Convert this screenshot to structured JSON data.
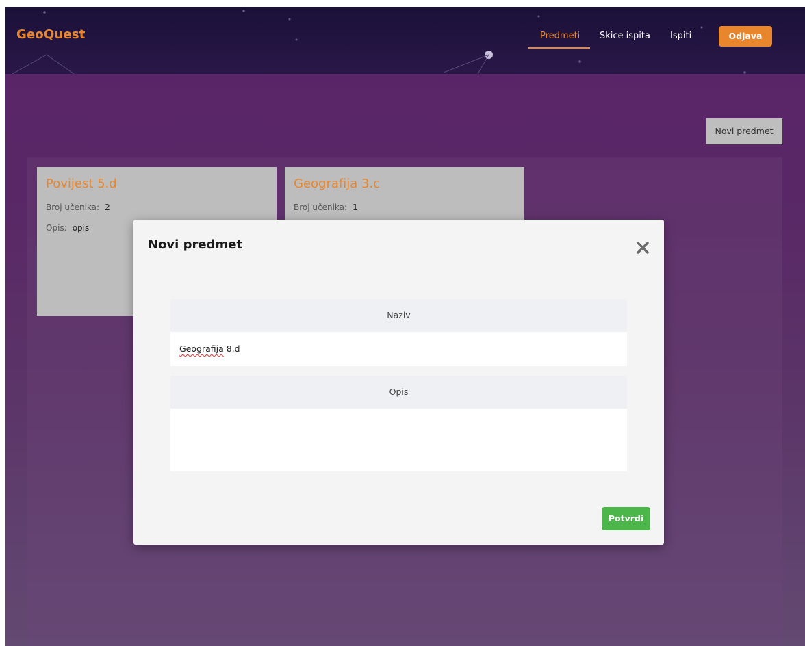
{
  "brand": "GeoQuest",
  "nav": {
    "items": [
      {
        "label": "Predmeti",
        "active": true
      },
      {
        "label": "Skice ispita",
        "active": false
      },
      {
        "label": "Ispiti",
        "active": false
      }
    ],
    "logout_label": "Odjava"
  },
  "new_subject_button": "Novi predmet",
  "cards": [
    {
      "title": "Povijest 5.d",
      "students_label": "Broj učenika:",
      "students_value": "2",
      "desc_label": "Opis:",
      "desc_value": "opis"
    },
    {
      "title": "Geografija 3.c",
      "students_label": "Broj učenika:",
      "students_value": "1"
    }
  ],
  "modal": {
    "title": "Novi predmet",
    "name_label": "Naziv",
    "name_value": "Geografija 8.d",
    "name_value_misspelled": "Geografija",
    "name_value_rest": " 8.d",
    "desc_label": "Opis",
    "desc_value": "",
    "confirm_label": "Potvrdi"
  },
  "colors": {
    "accent": "#e8862e",
    "confirm": "#4cb64b"
  }
}
